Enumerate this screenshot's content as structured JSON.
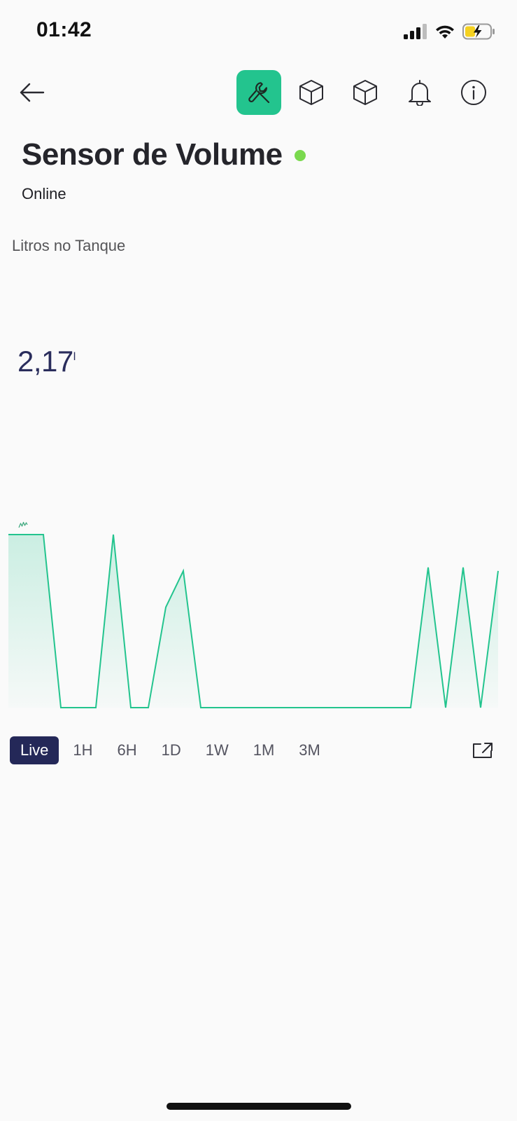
{
  "status_bar": {
    "time": "01:42",
    "icons": [
      "cellular-signal-icon",
      "wifi-icon",
      "battery-charging-icon"
    ],
    "battery_color": "#f5d120"
  },
  "toolbar": {
    "buttons": [
      {
        "name": "back-arrow-icon"
      },
      {
        "name": "wrench-icon",
        "active": true
      },
      {
        "name": "cube-icon"
      },
      {
        "name": "cube-icon"
      },
      {
        "name": "bell-icon"
      },
      {
        "name": "info-icon"
      }
    ],
    "active_color": "#23c48e"
  },
  "device": {
    "title": "Sensor de Volume",
    "status": "Online",
    "status_color": "#7ad94e"
  },
  "widget": {
    "label": "Litros no Tanque",
    "value": "2,17",
    "unit": "l",
    "chart_color": "#23c48e",
    "chart_icon": "sparkline-icon"
  },
  "chart_data": {
    "type": "area",
    "values": [
      1,
      1,
      1,
      0,
      0,
      0,
      1,
      0,
      0,
      0.58,
      0.79,
      0,
      0,
      0,
      0,
      0,
      0,
      0,
      0,
      0,
      0,
      0,
      0,
      0,
      0.81,
      0,
      0.81,
      0,
      0.79
    ],
    "ylim": [
      0,
      1
    ],
    "grid": false
  },
  "time_range": {
    "options": [
      "Live",
      "1H",
      "6H",
      "1D",
      "1W",
      "1M",
      "3M"
    ],
    "selected": "Live",
    "selected_color": "#242858"
  },
  "fullscreen_icon": "expand-icon"
}
